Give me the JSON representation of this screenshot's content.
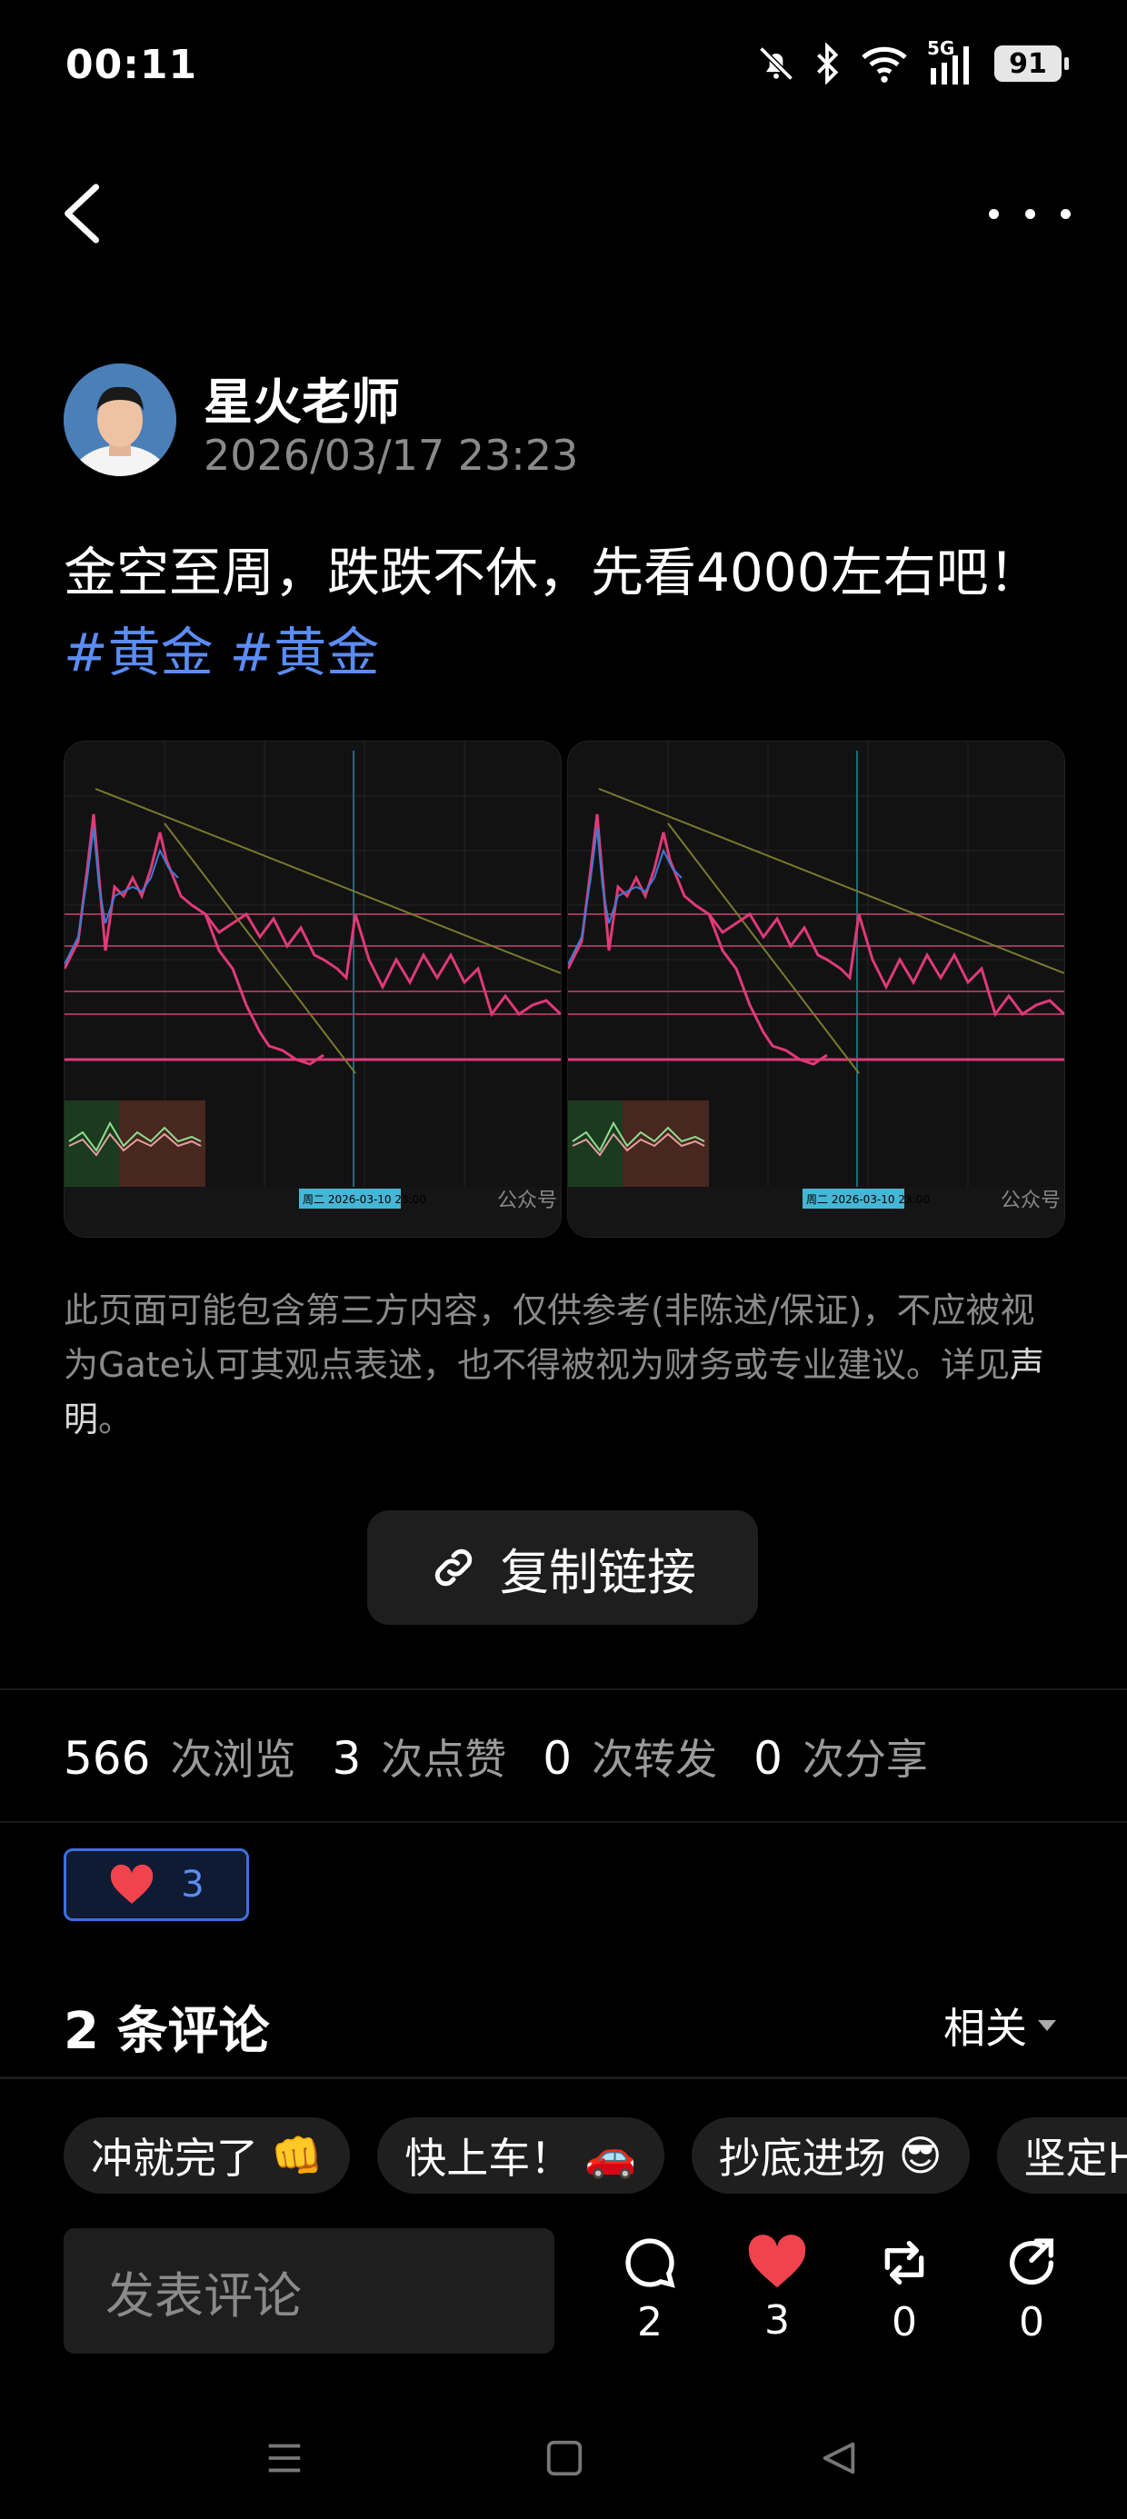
{
  "status_bar": {
    "time": "00:11",
    "network": "5G",
    "battery": "91",
    "icons": [
      "mute-bell-icon",
      "bluetooth-icon",
      "wifi-icon",
      "signal-icon",
      "battery-icon"
    ]
  },
  "nav": {
    "back_icon": "back-chevron-icon",
    "more_icon": "more-dots-icon"
  },
  "post": {
    "author": "星火老师",
    "timestamp": "2026/03/17 23:23",
    "text": "金空至周，跌跌不休，先看4000左右吧！",
    "tags": [
      "#黄金",
      "#黄金"
    ],
    "images": [
      {
        "caption_left": "周二 2026-03-10 23:00",
        "watermark": "公众号"
      },
      {
        "caption_left": "周二 2026-03-10 23:00",
        "watermark": "公众号"
      }
    ]
  },
  "disclaimer": {
    "text": "此页面可能包含第三方内容，仅供参考(非陈述/保证)，不应被视为Gate认可其观点表述，也不得被视为财务或专业建议。详见",
    "link": "声明",
    "end": "。"
  },
  "copy_link": {
    "label": "复制链接",
    "icon": "link-icon"
  },
  "stats": {
    "views": "566",
    "views_label": "次浏览",
    "likes": "3",
    "likes_label": "次点赞",
    "reposts": "0",
    "reposts_label": "次转发",
    "shares": "0",
    "shares_label": "次分享"
  },
  "reaction": {
    "icon": "heart-icon",
    "count": "3"
  },
  "comments": {
    "title": "2 条评论",
    "sort_label": "相关"
  },
  "quick_replies": [
    {
      "label": "冲就完了",
      "emoji": "👊"
    },
    {
      "label": "快上车！",
      "emoji": "🚗"
    },
    {
      "label": "抄底进场",
      "emoji": "😎"
    },
    {
      "label": "坚定H",
      "emoji": ""
    }
  ],
  "composer": {
    "placeholder": "发表评论"
  },
  "actions": {
    "comments": "2",
    "likes": "3",
    "reposts": "0",
    "shares": "0"
  },
  "colors": {
    "accent_blue": "#5b8cf5",
    "heart_red": "#f0434d",
    "chart_line": "#e03a78"
  }
}
